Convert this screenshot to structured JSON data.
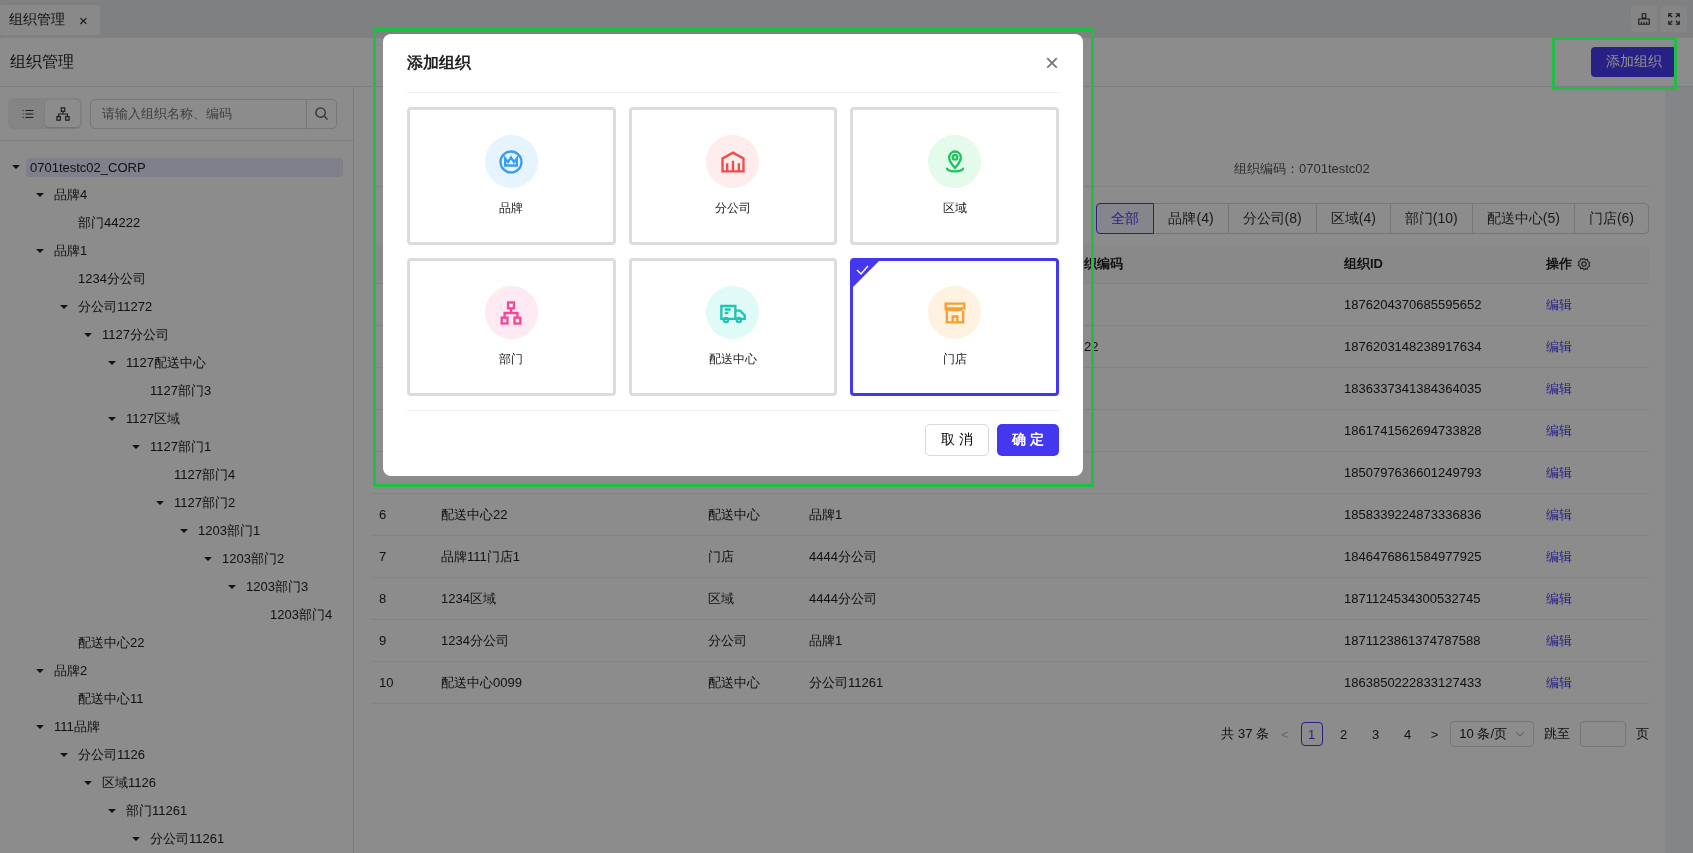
{
  "top_tabs": [
    {
      "label": "组织管理",
      "close": "×"
    }
  ],
  "header": {
    "title": "组织管理",
    "add_button": "添加组织"
  },
  "sidebar": {
    "view_toggle": [
      {
        "kind": "list",
        "selected": false
      },
      {
        "kind": "tree",
        "selected": true
      }
    ],
    "search": {
      "placeholder": "请输入组织名称、编码"
    },
    "tree": [
      {
        "label": "0701testc02_CORP",
        "selected": true,
        "expanded": true,
        "children": [
          {
            "label": "品牌4",
            "selected": false,
            "expanded": true,
            "children": [
              {
                "label": "部门44222",
                "selected": false
              }
            ]
          },
          {
            "label": "品牌1",
            "selected": false,
            "expanded": true,
            "children": [
              {
                "label": "1234分公司",
                "selected": false
              },
              {
                "label": "分公司11272",
                "selected": false,
                "expanded": true,
                "children": [
                  {
                    "label": "1127分公司",
                    "selected": false,
                    "expanded": true,
                    "children": [
                      {
                        "label": "1127配送中心",
                        "selected": false,
                        "expanded": true,
                        "children": [
                          {
                            "label": "1127部门3",
                            "selected": false
                          }
                        ]
                      },
                      {
                        "label": "1127区域",
                        "selected": false,
                        "expanded": true,
                        "children": [
                          {
                            "label": "1127部门1",
                            "selected": false,
                            "expanded": true,
                            "children": [
                              {
                                "label": "1127部门4",
                                "selected": false
                              },
                              {
                                "label": "1127部门2",
                                "selected": false,
                                "expanded": true,
                                "children": [
                                  {
                                    "label": "1203部门1",
                                    "selected": false,
                                    "expanded": true,
                                    "children": [
                                      {
                                        "label": "1203部门2",
                                        "selected": false,
                                        "expanded": true,
                                        "children": [
                                          {
                                            "label": "1203部门3",
                                            "selected": false,
                                            "expanded": true,
                                            "children": [
                                              {
                                                "label": "1203部门4",
                                                "selected": false
                                              }
                                            ]
                                          }
                                        ]
                                      }
                                    ]
                                  }
                                ]
                              }
                            ]
                          }
                        ]
                      }
                    ]
                  }
                ]
              },
              {
                "label": "配送中心22",
                "selected": false
              }
            ]
          },
          {
            "label": "品牌2",
            "selected": false,
            "expanded": true,
            "children": [
              {
                "label": "配送中心11",
                "selected": false
              }
            ]
          },
          {
            "label": "111品牌",
            "selected": false,
            "expanded": true,
            "children": [
              {
                "label": "分公司1126",
                "selected": false,
                "expanded": true,
                "children": [
                  {
                    "label": "区域1126",
                    "selected": false,
                    "expanded": true,
                    "children": [
                      {
                        "label": "部门11261",
                        "selected": false,
                        "expanded": true,
                        "children": [
                          {
                            "label": "分公司11261",
                            "selected": false,
                            "expanded": true
                          }
                        ]
                      }
                    ]
                  }
                ]
              }
            ]
          }
        ]
      }
    ]
  },
  "info": {
    "code": "组织编码：0701testc02"
  },
  "filter_tabs": [
    {
      "label": "全部",
      "selected": true
    },
    {
      "label": "品牌(4)",
      "selected": false
    },
    {
      "label": "分公司(8)",
      "selected": false
    },
    {
      "label": "区域(4)",
      "selected": false
    },
    {
      "label": "部门(10)",
      "selected": false
    },
    {
      "label": "配送中心(5)",
      "selected": false
    },
    {
      "label": "门店(6)",
      "selected": false
    }
  ],
  "table": {
    "columns": [
      {},
      {},
      {},
      {},
      {
        "label": "织编码"
      },
      {
        "label": "组织ID"
      },
      {
        "label": "操作",
        "settings": true
      }
    ],
    "rows": [
      {
        "id": "1876204370685595652",
        "action": "编辑"
      },
      {
        "code": "22",
        "id": "1876203148238917634",
        "action": "编辑"
      },
      {
        "id": "1836337341384364035",
        "action": "编辑"
      },
      {
        "id": "1861741562694733828",
        "action": "编辑"
      },
      {
        "id": "1850797636601249793",
        "action": "编辑"
      },
      {
        "seq": "6",
        "name": "配送中心22",
        "type": "配送中心",
        "parent": "品牌1",
        "id": "1858339224873336836",
        "action": "编辑"
      },
      {
        "seq": "7",
        "name": "品牌111门店1",
        "type": "门店",
        "parent": "4444分公司",
        "id": "1846476861584977925",
        "action": "编辑"
      },
      {
        "seq": "8",
        "name": "1234区域",
        "type": "区域",
        "parent": "4444分公司",
        "id": "1871124534300532745",
        "action": "编辑"
      },
      {
        "seq": "9",
        "name": "1234分公司",
        "type": "分公司",
        "parent": "品牌1",
        "id": "1871123861374787588",
        "action": "编辑"
      },
      {
        "seq": "10",
        "name": "配送中心0099",
        "type": "配送中心",
        "parent": "分公司11261",
        "id": "1863850222833127433",
        "action": "编辑"
      }
    ]
  },
  "pagination": {
    "total": "共 37 条",
    "prev": "<",
    "pages": [
      {
        "label": "1",
        "selected": true
      },
      {
        "label": "2",
        "selected": false
      },
      {
        "label": "3",
        "selected": false
      },
      {
        "label": "4",
        "selected": false
      }
    ],
    "next": ">",
    "page_size": "10 条/页",
    "jump_label": "跳至",
    "page_unit": "页"
  },
  "dialog": {
    "title": "添加组织",
    "close": "×",
    "cards": [
      {
        "kind": "brand",
        "label": "品牌",
        "color": "#3b9cf5",
        "selected": false
      },
      {
        "kind": "branch",
        "label": "分公司",
        "color": "#f04b4b",
        "selected": false
      },
      {
        "kind": "region",
        "label": "区域",
        "color": "#22c063",
        "selected": false
      },
      {
        "kind": "department",
        "label": "部门",
        "color": "#f0489a",
        "selected": false
      },
      {
        "kind": "distribution",
        "label": "配送中心",
        "color": "#1fc4b4",
        "selected": false
      },
      {
        "kind": "store",
        "label": "门店",
        "color": "#f5a030",
        "selected": true
      }
    ],
    "cancel": "取 消",
    "confirm": "确 定"
  }
}
